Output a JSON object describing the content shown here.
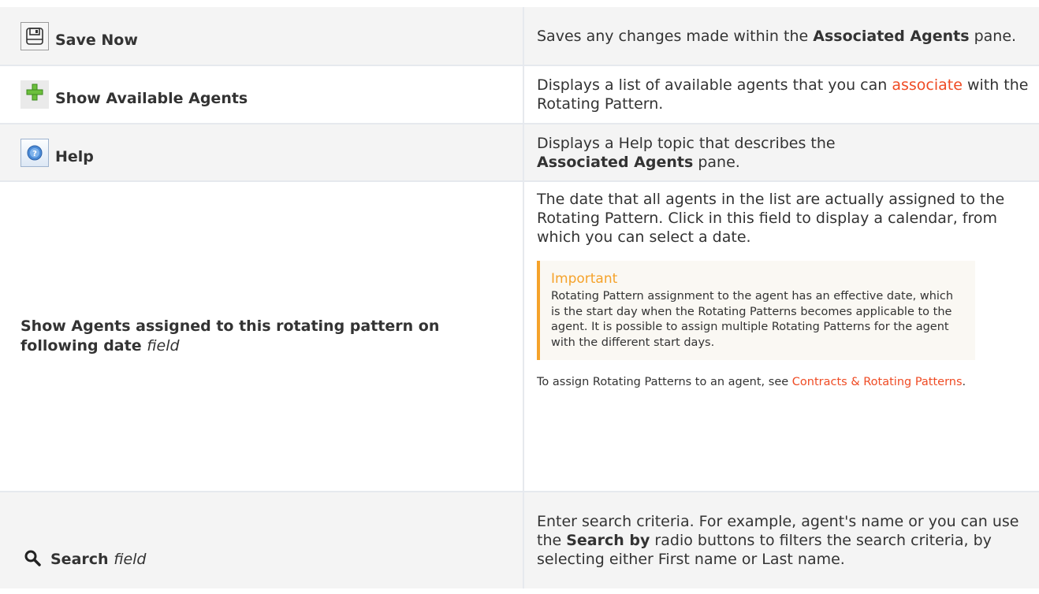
{
  "rows": [
    {
      "icon": "save-icon",
      "term": "Save Now",
      "desc_pre": "Saves any changes made within the ",
      "desc_bold": "Associated Agents",
      "desc_post": " pane."
    },
    {
      "icon": "plus-icon",
      "term": "Show Available Agents",
      "desc_pre": "Displays a list of available agents that you can ",
      "desc_link": "associate",
      "desc_post": " with the Rotating Pattern."
    },
    {
      "icon": "help-icon",
      "term": "Help",
      "desc_pre": "Displays a Help topic that describes the ",
      "desc_bold": "Associated Agents",
      "desc_post": " pane."
    },
    {
      "term": "Show Agents assigned to this rotating pattern on following date",
      "term_suffix": "field",
      "desc": "The date that all agents in the list are actually assigned to the Rotating Pattern. Click in this field to display a calendar, from which you can select a date.",
      "important_title": "Important",
      "important_body": "Rotating Pattern assignment to the agent has an effective date, which is the start day when the Rotating Patterns becomes applicable to the agent. It is possible to assign multiple Rotating Patterns for the agent with the different start days.",
      "note_pre": "To assign Rotating Patterns to an agent, see ",
      "note_link": "Contracts & Rotating Patterns",
      "note_post": "."
    },
    {
      "icon": "search-icon",
      "term": "Search",
      "term_suffix": "field",
      "desc_pre": "Enter search criteria. For example, agent's name or you can use the ",
      "desc_bold": "Search by",
      "desc_post": " radio buttons to filters the search criteria, by selecting either First name or Last name."
    }
  ],
  "colors": {
    "link": "#ef4b24",
    "important": "#f5a22a"
  }
}
